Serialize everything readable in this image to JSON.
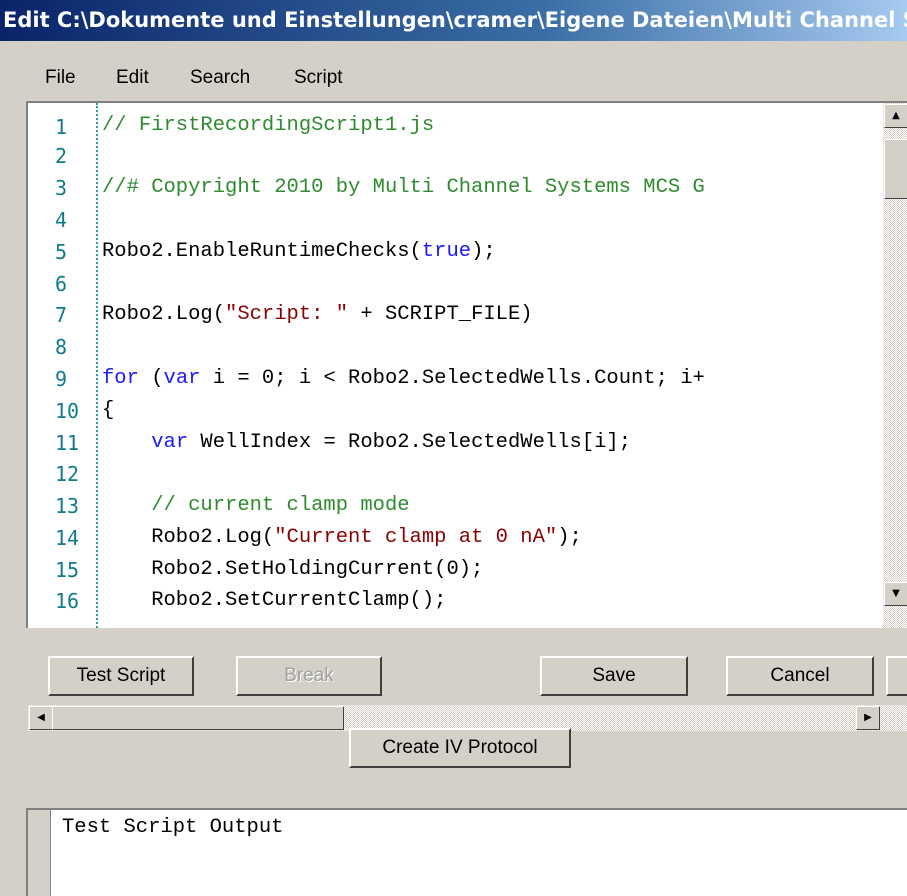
{
  "window": {
    "title": "Edit C:\\Dokumente und Einstellungen\\cramer\\Eigene Dateien\\Multi Channel S..."
  },
  "menu": [
    "File",
    "Edit",
    "Search",
    "Script"
  ],
  "editor": {
    "line_numbers": [
      "1",
      "2",
      "3",
      "4",
      "5",
      "6",
      "7",
      "8",
      "9",
      "10",
      "11",
      "12",
      "13",
      "14",
      "15",
      "16"
    ],
    "lines": [
      [
        {
          "t": "// FirstRecordingScript1.js",
          "c": "comment"
        }
      ],
      [],
      [
        {
          "t": "//# Copyright 2010 by Multi Channel Systems MCS G",
          "c": "comment"
        }
      ],
      [],
      [
        {
          "t": "Robo2.EnableRuntimeChecks(",
          "c": "plain"
        },
        {
          "t": "true",
          "c": "keyword"
        },
        {
          "t": ");",
          "c": "plain"
        }
      ],
      [],
      [
        {
          "t": "Robo2.Log(",
          "c": "plain"
        },
        {
          "t": "\"Script: \"",
          "c": "string"
        },
        {
          "t": " + SCRIPT_FILE)",
          "c": "plain"
        }
      ],
      [],
      [
        {
          "t": "for",
          "c": "keyword"
        },
        {
          "t": " (",
          "c": "plain"
        },
        {
          "t": "var",
          "c": "keyword"
        },
        {
          "t": " i = 0; i < Robo2.SelectedWells.Count; i+",
          "c": "plain"
        }
      ],
      [
        {
          "t": "{",
          "c": "plain"
        }
      ],
      [
        {
          "t": "    ",
          "c": "plain"
        },
        {
          "t": "var",
          "c": "keyword"
        },
        {
          "t": " WellIndex = Robo2.SelectedWells[i];",
          "c": "plain"
        }
      ],
      [],
      [
        {
          "t": "    // current clamp mode",
          "c": "comment"
        }
      ],
      [
        {
          "t": "    Robo2.Log(",
          "c": "plain"
        },
        {
          "t": "\"Current clamp at 0 nA\"",
          "c": "string"
        },
        {
          "t": ");",
          "c": "plain"
        }
      ],
      [
        {
          "t": "    Robo2.SetHoldingCurrent(0);",
          "c": "plain"
        }
      ],
      [
        {
          "t": "    Robo2.SetCurrentClamp();",
          "c": "plain"
        }
      ]
    ]
  },
  "buttons": {
    "test_script": "Test Script",
    "break": "Break",
    "save": "Save",
    "cancel": "Cancel",
    "create_iv": "Create IV Protocol"
  },
  "output": {
    "text": "Test Script Output"
  },
  "icons": {
    "scroll_up": "arrow-up-icon",
    "scroll_down": "arrow-down-icon",
    "scroll_left": "arrow-left-icon",
    "scroll_right": "arrow-right-icon"
  }
}
